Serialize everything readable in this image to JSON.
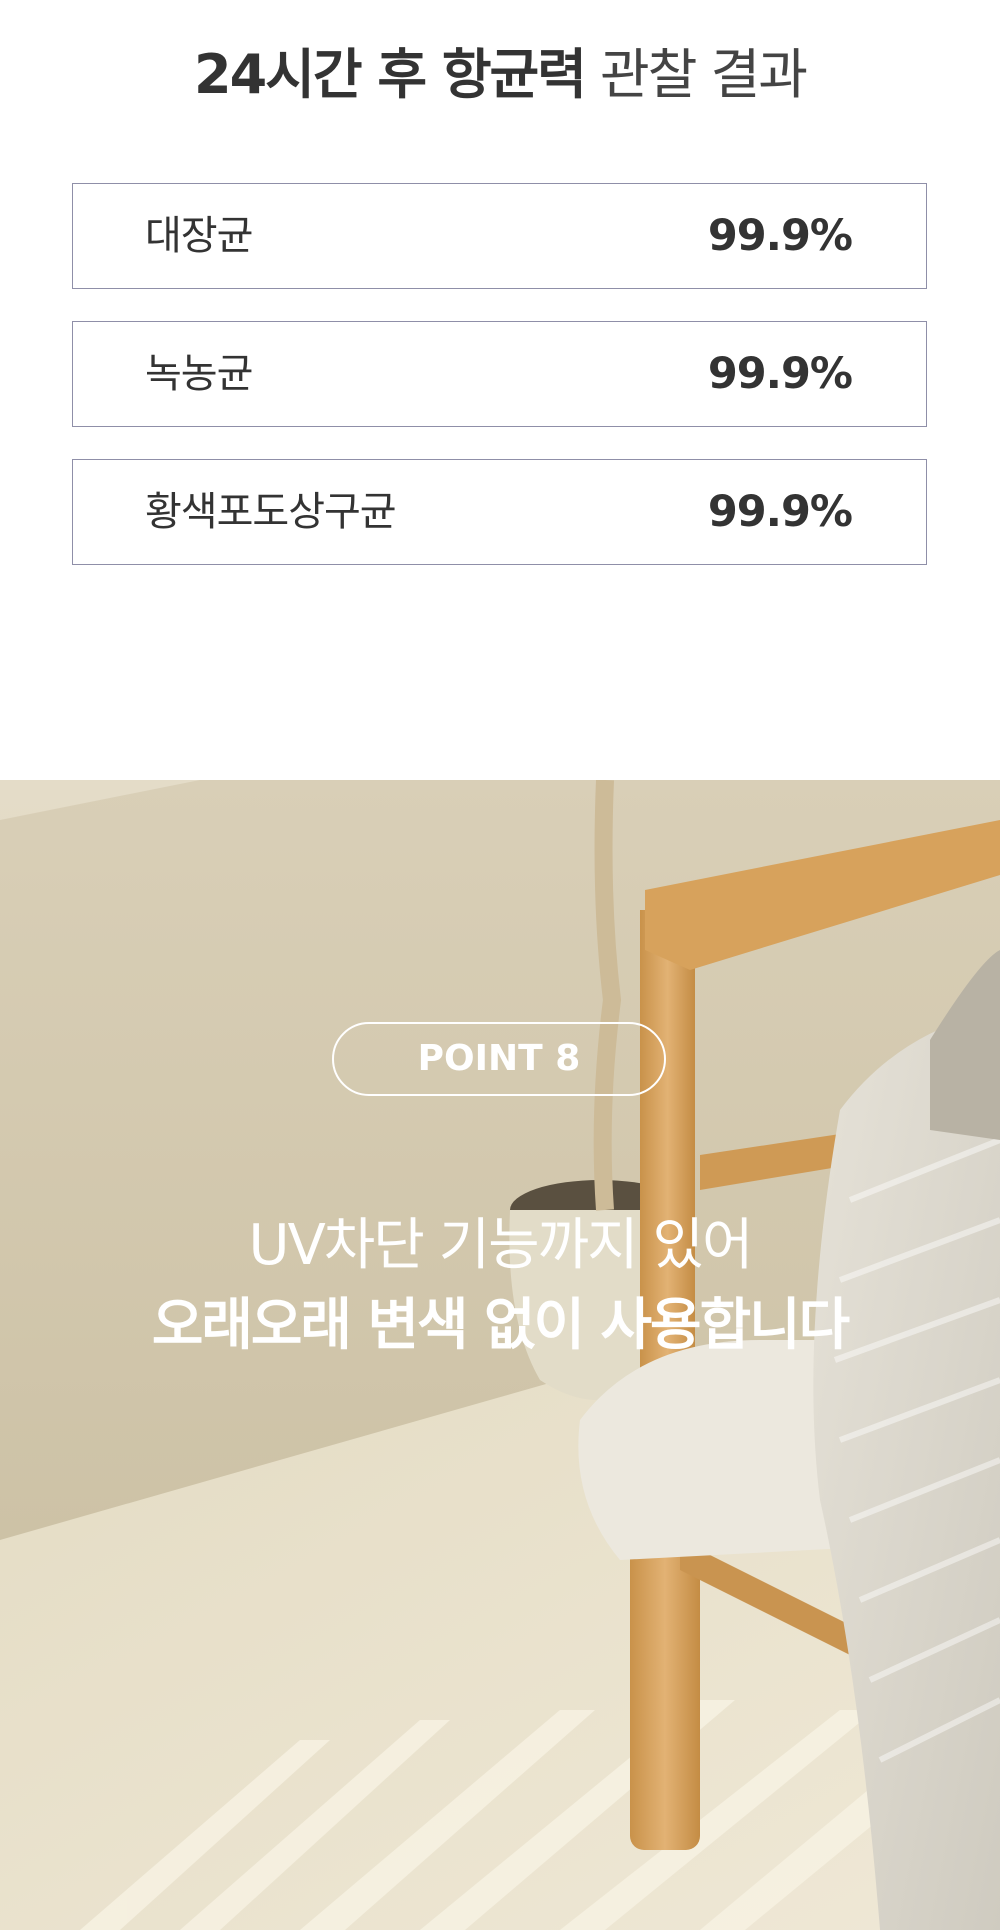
{
  "title": {
    "bold": "24시간 후 항균력",
    "light": "관찰 결과"
  },
  "results": [
    {
      "label": "대장균",
      "value": "99.9%"
    },
    {
      "label": "녹농균",
      "value": "99.9%"
    },
    {
      "label": "황색포도상구균",
      "value": "99.9%"
    }
  ],
  "point": {
    "badge": "POINT 8",
    "line1": "UV차단 기능까지 있어",
    "line2": "오래오래 변색 없이 사용합니다"
  },
  "colors": {
    "text": "#333333",
    "border": "#8f8fa8",
    "overlay_text": "#ffffff"
  }
}
